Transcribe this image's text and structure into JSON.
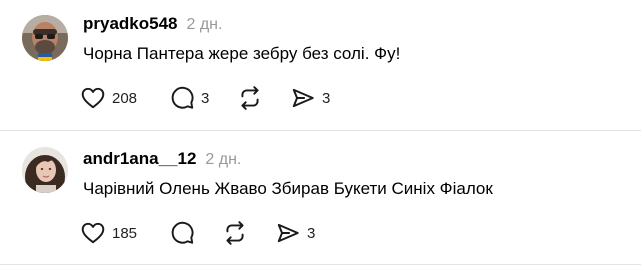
{
  "posts": [
    {
      "username": "pryadko548",
      "time": "2 дн.",
      "text": "Чорна Пантера жере зебру без солі. Фу!",
      "likes": "208",
      "replies": "3",
      "reposts": "",
      "shares": "3"
    },
    {
      "username": "andr1ana__12",
      "time": "2 дн.",
      "text": "Чарівний Олень Жваво Збирав Букети Синіх Фіалок",
      "likes": "185",
      "replies": "",
      "reposts": "",
      "shares": "3"
    }
  ],
  "icons": {
    "like": "heart-icon",
    "reply": "comment-icon",
    "repost": "repost-icon",
    "share": "send-icon"
  },
  "colors": {
    "text": "#000000",
    "muted": "#999999",
    "divider": "#e3e3e3",
    "icon": "#1a1a1a"
  }
}
